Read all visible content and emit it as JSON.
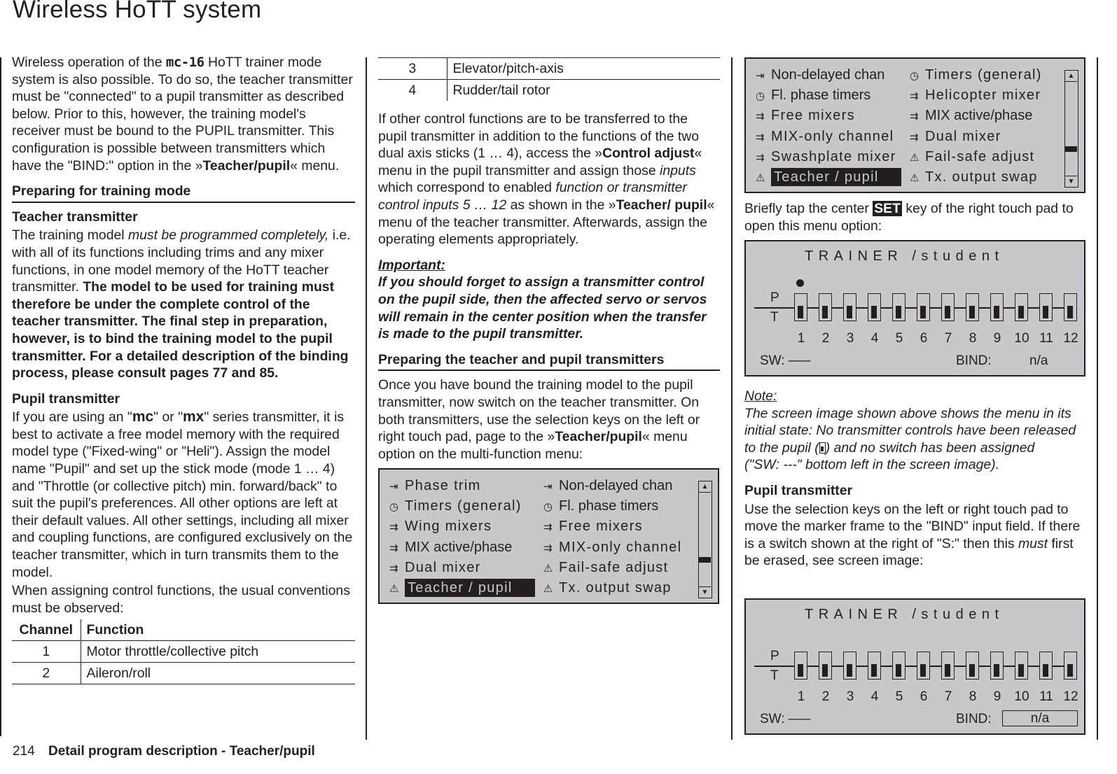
{
  "page": {
    "title": "Wireless HoTT system",
    "footer_page_number": "214",
    "footer_section": "Detail program description - Teacher/pupil"
  },
  "col1": {
    "intro_a": "Wireless operation of the ",
    "brand": "mc-16",
    "intro_b": " HoTT trainer mode system is also possible. To do so, the teacher transmitter must be \"connected\" to a pupil transmitter as described below. Prior to this, however, the training model's receiver must be bound to the PUPIL transmitter. This configuration is possible between transmitters which have the \"BIND:\" option in the ",
    "intro_menu": "Teacher/pupil",
    "intro_c": " menu.",
    "heading_preparing": "Preparing for training mode",
    "heading_teacher": "Teacher transmitter",
    "teacher_a": "The training model ",
    "teacher_italic": "must be programmed completely,",
    "teacher_b": " i.e. with all of its functions including trims and any mixer functions, in one model memory of the HoTT teacher transmitter. ",
    "teacher_bold": "The model to be used for training must therefore be under the complete control of the teacher transmitter. The final step in preparation, however, is to bind the training model to the pupil transmitter. For a detailed description of the binding process, please consult pages 77 and 85.",
    "heading_pupil": "Pupil transmitter",
    "pupil_a": "If you are using an \"",
    "pupil_mc": "mc",
    "pupil_b": "\" or \"",
    "pupil_mx": "mx",
    "pupil_c": "\" series transmitter, it is best to activate a free model memory with the required model type (\"Fixed-wing\" or \"Heli\"). Assign the model name \"Pupil\" and set up the stick mode (mode 1 … 4) and \"Throttle (or collective pitch) min. forward/back\" to suit the pupil's preferences. All other options are left at their default values. All other settings, including all mixer and coupling functions, are configured exclusively on the teacher transmitter, which in turn transmits them to the model.",
    "conventions": "When assigning control functions, the usual conventions must be observed:"
  },
  "channel_table": {
    "headers": [
      "Channel",
      "Function"
    ],
    "rows": [
      {
        "channel": "1",
        "function": "Motor throttle/collective pitch"
      },
      {
        "channel": "2",
        "function": "Aileron/roll"
      },
      {
        "channel": "3",
        "function": "Elevator/pitch-axis"
      },
      {
        "channel": "4",
        "function": "Rudder/tail rotor"
      }
    ]
  },
  "col2": {
    "other_a": "If other control functions are to be transferred to the pupil transmitter in addition to the functions of the two dual axis sticks (1 … 4), access the ",
    "other_menu": "Control adjust",
    "other_b": " menu in the pupil transmitter and assign those ",
    "other_inputs": "inputs",
    "other_c": " which correspond to enabled ",
    "other_italic": "function or transmitter control inputs 5 … 12",
    "other_d": " as shown in the ",
    "other_menu2": "Teacher/ pupil",
    "other_e": " menu of the teacher transmitter. Afterwards, assign the operating elements appropriately.",
    "important_label": "Important:",
    "important_text": "If you should forget to assign a transmitter control on the pupil side, then the affected servo or servos will remain in the center position when the transfer is made to the pupil transmitter.",
    "heading_prep2": "Preparing the teacher and pupil transmitters",
    "prep_a": "Once you have bound the training model to the pupil transmitter, now switch on the teacher transmitter. On both transmitters, use the selection keys on the left or right touch pad, page to the ",
    "prep_menu": "Teacher/pupil",
    "prep_b": " menu option on the multi-function menu:"
  },
  "menu_screen_1": {
    "left": [
      {
        "icon": "trim-icon",
        "glyph": "⇥",
        "label": "Phase trim"
      },
      {
        "icon": "timer-icon",
        "glyph": "◷",
        "label": "Timers (general)"
      },
      {
        "icon": "mixer-icon",
        "glyph": "⇉",
        "label": "Wing mixers"
      },
      {
        "icon": "mixer-icon",
        "glyph": "⇉",
        "label": "MIX active/phase"
      },
      {
        "icon": "mixer-icon",
        "glyph": "⇉",
        "label": "Dual mixer"
      },
      {
        "icon": "warning-icon",
        "glyph": "⚠",
        "label": "Teacher / pupil",
        "selected": true
      }
    ],
    "right": [
      {
        "icon": "trim-icon",
        "glyph": "⇥",
        "label": "Non-delayed chan"
      },
      {
        "icon": "timer-icon",
        "glyph": "◷",
        "label": "Fl. phase timers"
      },
      {
        "icon": "mixer-icon",
        "glyph": "⇉",
        "label": "Free mixers"
      },
      {
        "icon": "mixer-icon",
        "glyph": "⇉",
        "label": "MIX-only channel"
      },
      {
        "icon": "warning-icon",
        "glyph": "⚠",
        "label": "Fail-safe adjust"
      },
      {
        "icon": "warning-icon",
        "glyph": "⚠",
        "label": "Tx. output swap"
      }
    ],
    "scroll_position": 0.72
  },
  "menu_screen_2": {
    "left": [
      {
        "icon": "trim-icon",
        "glyph": "⇥",
        "label": "Non-delayed chan"
      },
      {
        "icon": "timer-icon",
        "glyph": "◷",
        "label": "Fl. phase timers"
      },
      {
        "icon": "mixer-icon",
        "glyph": "⇉",
        "label": "Free mixers"
      },
      {
        "icon": "mixer-icon",
        "glyph": "⇉",
        "label": "MIX-only channel"
      },
      {
        "icon": "mixer-icon",
        "glyph": "⇉",
        "label": "Swashplate mixer"
      },
      {
        "icon": "warning-icon",
        "glyph": "⚠",
        "label": "Teacher / pupil",
        "selected": true
      }
    ],
    "right": [
      {
        "icon": "timer-icon",
        "glyph": "◷",
        "label": "Timers (general)"
      },
      {
        "icon": "mixer-icon",
        "glyph": "⇉",
        "label": "Helicopter mixer"
      },
      {
        "icon": "mixer-icon",
        "glyph": "⇉",
        "label": "MIX active/phase"
      },
      {
        "icon": "mixer-icon",
        "glyph": "⇉",
        "label": "Dual mixer"
      },
      {
        "icon": "warning-icon",
        "glyph": "⚠",
        "label": "Fail-safe adjust"
      },
      {
        "icon": "warning-icon",
        "glyph": "⚠",
        "label": "Tx. output swap"
      }
    ],
    "scroll_position": 0.72
  },
  "col3": {
    "tap_a": "Briefly tap the center ",
    "set_key": "SET",
    "tap_b": " key of the right touch pad to open this menu option:",
    "note_label": "Note:",
    "note_a": "The screen image shown above shows the menu in its initial state: No transmitter controls have been released to the pupil (",
    "note_b": ") and no switch has been assigned",
    "note_c": "(\"SW: ---\" bottom left in the screen image).",
    "heading_pupil": "Pupil transmitter",
    "pupil_a": "Use the selection keys on the left or right touch pad to move the marker frame to the \"BIND\" input field. If there is a switch shown at the right of \"S:\" then this ",
    "pupil_must": "must",
    "pupil_b": " first be erased, see screen image:"
  },
  "trainer_screen_1": {
    "title": "TRAINER  /student",
    "p_label": "P",
    "t_label": "T",
    "channels": [
      "1",
      "2",
      "3",
      "4",
      "5",
      "6",
      "7",
      "8",
      "9",
      "10",
      "11",
      "12"
    ],
    "channel_states": [
      "T",
      "T",
      "T",
      "T",
      "T",
      "T",
      "T",
      "T",
      "T",
      "T",
      "T",
      "T"
    ],
    "cursor_channel": "1",
    "sw_label": "SW:",
    "sw_value": "–––",
    "bind_label": "BIND:",
    "bind_value": "n/a",
    "bind_selected": false
  },
  "trainer_screen_2": {
    "title": "TRAINER  /student",
    "p_label": "P",
    "t_label": "T",
    "channels": [
      "1",
      "2",
      "3",
      "4",
      "5",
      "6",
      "7",
      "8",
      "9",
      "10",
      "11",
      "12"
    ],
    "channel_states": [
      "T",
      "T",
      "T",
      "T",
      "T",
      "T",
      "T",
      "T",
      "T",
      "T",
      "T",
      "T"
    ],
    "sw_label": "SW:",
    "sw_value": "–––",
    "bind_label": "BIND:",
    "bind_value": "n/a",
    "bind_selected": true
  }
}
